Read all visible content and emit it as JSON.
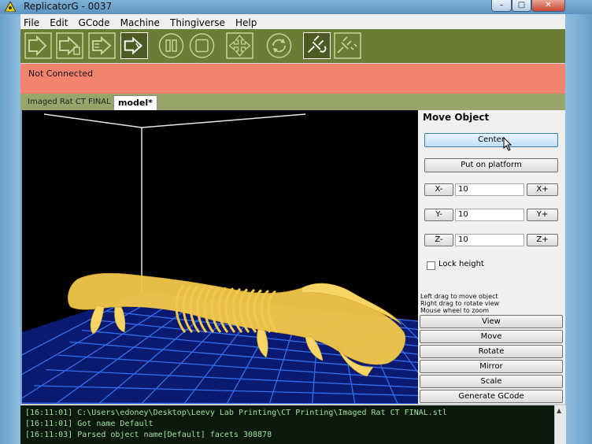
{
  "window": {
    "title": "ReplicatorG - 0037"
  },
  "menu": [
    "File",
    "Edit",
    "GCode",
    "Machine",
    "Thingiverse",
    "Help"
  ],
  "toolbar": {
    "buttons": [
      "build-icon",
      "build-to-file-icon",
      "upload-icon",
      "generate-gcode-icon",
      "pause-icon",
      "stop-icon",
      "control-panel-icon",
      "reset-icon",
      "connect-icon",
      "disconnect-icon"
    ]
  },
  "status": {
    "text": "Not Connected"
  },
  "tabs": [
    {
      "label": "Imaged Rat CT FINAL"
    },
    {
      "label": "model*"
    }
  ],
  "panel": {
    "title": "Move Object",
    "center": "Center",
    "put_on_platform": "Put on platform",
    "x_minus": "X-",
    "x_value": "10",
    "x_plus": "X+",
    "y_minus": "Y-",
    "y_value": "10",
    "y_plus": "Y+",
    "z_minus": "Z-",
    "z_value": "10",
    "z_plus": "Z+",
    "lock_height": "Lock height",
    "lock_height_checked": false,
    "hints": [
      "Left drag to move object",
      "Right drag to rotate view",
      "Mouse wheel to zoom"
    ],
    "modes": [
      "View",
      "Move",
      "Rotate",
      "Mirror",
      "Scale",
      "Generate GCode"
    ]
  },
  "console": [
    {
      "time": "[16:11:01]",
      "text": "C:\\Users\\edoney\\Desktop\\Leevy Lab Printing\\CT Printing\\Imaged Rat CT FINAL.stl"
    },
    {
      "time": "[16:11:01]",
      "text": "Got name Default"
    },
    {
      "time": "[16:11:03]",
      "text": "Parsed object name[Default] facets 308878"
    }
  ],
  "colors": {
    "toolbar": "#6b7d34",
    "status": "#f4836d",
    "tabs": "#97a56a",
    "grid": "#2f6ff0",
    "model": "#f3c84a",
    "console_text": "#9ee19e"
  }
}
